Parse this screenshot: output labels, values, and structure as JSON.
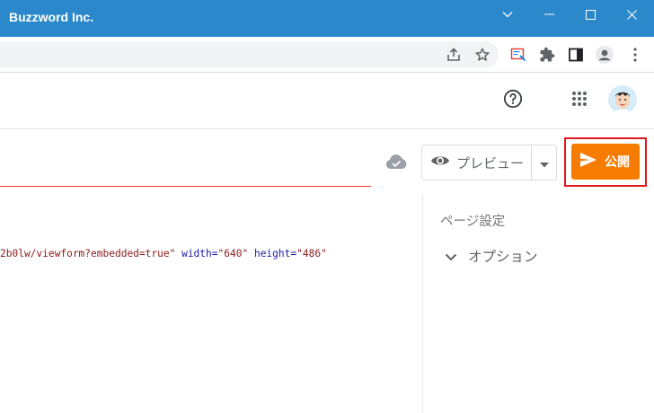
{
  "window": {
    "title": "Buzzword Inc.",
    "icons": [
      "chevron-down-icon",
      "minimize-icon",
      "maximize-icon",
      "close-icon"
    ]
  },
  "browser_toolbar": {
    "icons": [
      "share-icon",
      "star-icon",
      "extension-screenshot-icon",
      "puzzle-icon",
      "side-panel-icon",
      "profile-icon",
      "more-vert-icon"
    ]
  },
  "app_header": {
    "icons": [
      "help-icon",
      "apps-grid-icon",
      "account-avatar"
    ]
  },
  "editor": {
    "save_status_icon": "cloud-done-icon",
    "preview_label": "プレビュー",
    "publish_label": "公開",
    "code": {
      "url_tail": "2b0lw/viewform?embedded=true\"",
      "attr_width": "width",
      "val_width": "\"640\"",
      "attr_height": "height",
      "val_height": "\"486\""
    }
  },
  "side_panel": {
    "title": "ページ設定",
    "option_label": "オプション"
  },
  "colors": {
    "titlebar": "#2b88cb",
    "publish": "#f57c00",
    "highlight": "#e0171d",
    "title_underline": "#e53935"
  }
}
